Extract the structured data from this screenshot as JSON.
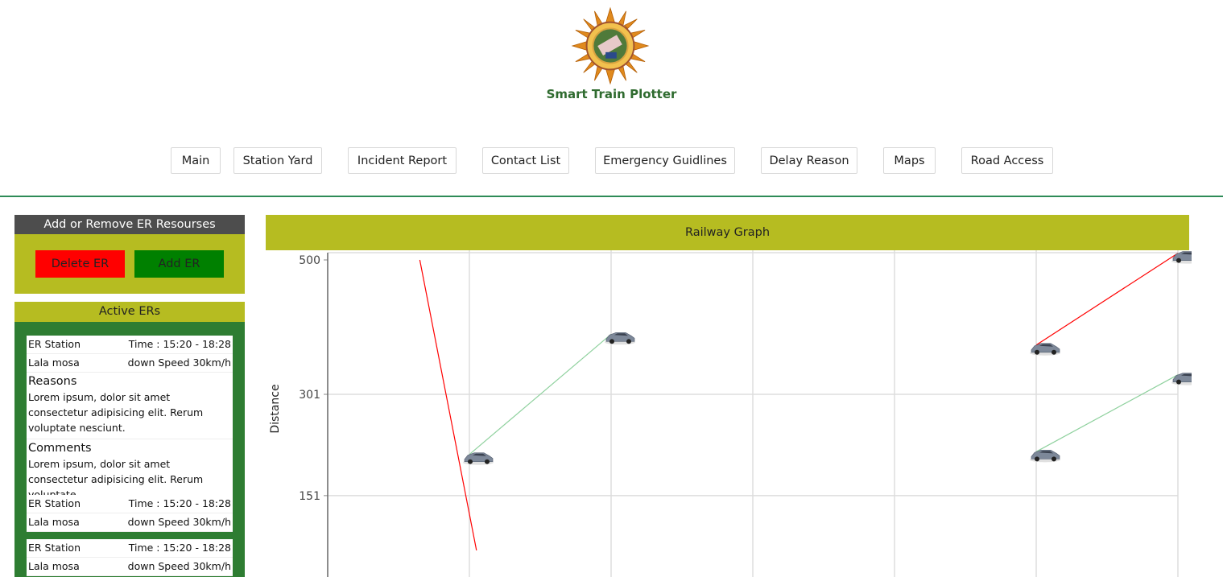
{
  "app": {
    "title": "Smart Train Plotter"
  },
  "nav": {
    "items": [
      {
        "label": "Main"
      },
      {
        "label": "Station Yard"
      },
      {
        "label": "Incident Report"
      },
      {
        "label": "Contact List"
      },
      {
        "label": "Emergency Guidlines"
      },
      {
        "label": "Delay Reason"
      },
      {
        "label": "Maps"
      },
      {
        "label": "Road Access"
      }
    ]
  },
  "er_panel": {
    "header": "Add or Remove ER Resourses",
    "delete_label": "Delete ER",
    "add_label": "Add ER",
    "active_header": "Active ERs"
  },
  "cards": [
    {
      "station": "ER Station",
      "time": "Time : 15:20 - 18:28",
      "name": "Lala mosa",
      "speed": "down Speed 30km/h",
      "reasons_title": "Reasons",
      "reasons_text": "Lorem ipsum, dolor sit amet consectetur adipisicing elit. Rerum voluptate nesciunt.",
      "comments_title": "Comments",
      "comments_text": "Lorem ipsum, dolor sit amet consectetur adipisicing elit. Rerum voluptate ."
    },
    {
      "station": "ER Station",
      "time": "Time : 15:20 - 18:28",
      "name": "Lala mosa",
      "speed": "down Speed 30km/h"
    },
    {
      "station": "ER Station",
      "time": "Time : 15:20 - 18:28",
      "name": "Lala mosa",
      "speed": "down Speed 30km/h"
    }
  ],
  "chart_data": {
    "type": "line",
    "title": "Railway Graph",
    "ylabel": "Distance",
    "xlabel": "",
    "yticks": [
      500,
      301,
      151
    ],
    "x_gridlines": 6,
    "grid": true,
    "colors": {
      "red_series": "#ff0000",
      "green_series": "#8fd19e",
      "header": "#b6bc21"
    },
    "icon": "car-icon",
    "series": [
      {
        "color": "red",
        "points": [
          [
            1.05,
            70
          ],
          [
            0.65,
            500
          ]
        ]
      },
      {
        "color": "green",
        "points": [
          [
            1.0,
            212
          ],
          [
            2.0,
            390
          ]
        ]
      },
      {
        "color": "red",
        "points": [
          [
            5.0,
            374
          ],
          [
            6.0,
            510
          ]
        ]
      },
      {
        "color": "green",
        "points": [
          [
            5.0,
            216
          ],
          [
            6.0,
            330
          ]
        ]
      }
    ],
    "markers": [
      [
        1.0,
        212
      ],
      [
        2.0,
        390
      ],
      [
        5.0,
        374
      ],
      [
        5.0,
        216
      ],
      [
        6.0,
        510
      ],
      [
        6.0,
        330
      ]
    ]
  }
}
